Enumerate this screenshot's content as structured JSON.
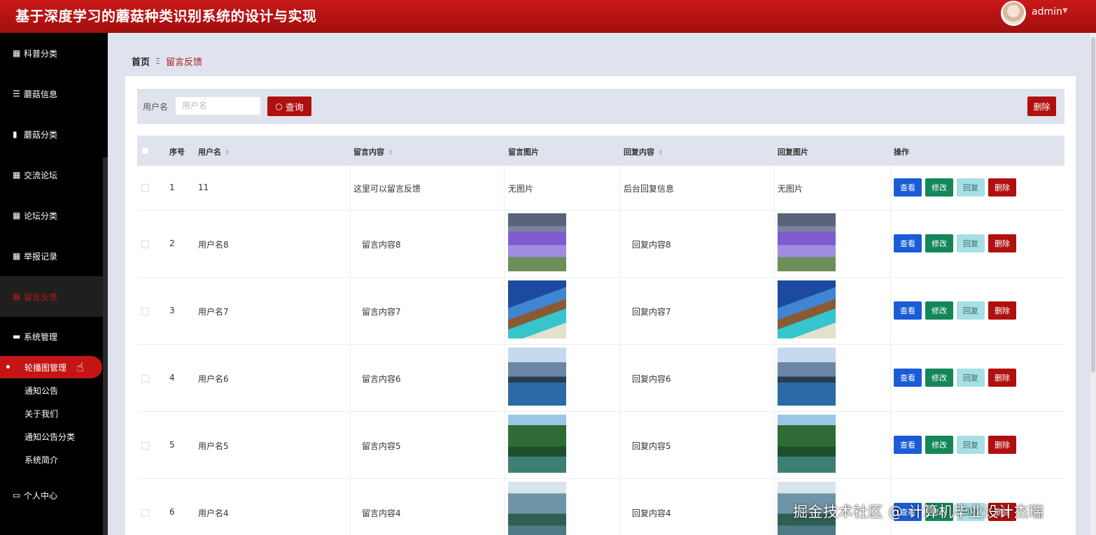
{
  "header": {
    "title": "基于深度学习的蘑菇种类识别系统的设计与实现",
    "username": "admin"
  },
  "sidebar": {
    "items": [
      {
        "label": "科普分类",
        "icon": "grid-icon"
      },
      {
        "label": "蘑菇信息",
        "icon": "list-icon"
      },
      {
        "label": "蘑菇分类",
        "icon": "book-icon"
      },
      {
        "label": "交流论坛",
        "icon": "grid-icon"
      },
      {
        "label": "论坛分类",
        "icon": "grid-icon"
      },
      {
        "label": "举报记录",
        "icon": "grid-icon"
      },
      {
        "label": "留言反馈",
        "icon": "grid-icon",
        "active": true
      },
      {
        "label": "系统管理",
        "icon": "monitor-icon"
      }
    ],
    "sub_items": [
      {
        "label": "轮播图管理",
        "selected": true
      },
      {
        "label": "通知公告"
      },
      {
        "label": "关于我们"
      },
      {
        "label": "通知公告分类"
      },
      {
        "label": "系统简介"
      }
    ],
    "personal": {
      "label": "个人中心",
      "icon": "card-icon"
    }
  },
  "breadcrumb": {
    "home": "首页",
    "separator": "Ξ",
    "current": "留言反馈"
  },
  "filter": {
    "label": "用户名",
    "placeholder": "用户名",
    "search_label": "查询",
    "delete_label": "删除"
  },
  "table": {
    "headers": [
      "序号",
      "用户名",
      "留言内容",
      "留言图片",
      "回复内容",
      "回复图片",
      "操作"
    ],
    "action_labels": {
      "view": "查看",
      "edit": "修改",
      "reply": "回复",
      "delete": "删除"
    },
    "rows": [
      {
        "index": "1",
        "username": "11",
        "content": "这里可以留言反馈",
        "image": "无图片",
        "reply": "后台回复信息",
        "reply_image": "无图片"
      },
      {
        "index": "2",
        "username": "用户名8",
        "content": "留言内容8",
        "image": "lavender-field",
        "reply": "回复内容8",
        "reply_image": "lavender-field"
      },
      {
        "index": "3",
        "username": "用户名7",
        "content": "留言内容7",
        "image": "tropical-beach",
        "reply": "回复内容7",
        "reply_image": "tropical-beach"
      },
      {
        "index": "4",
        "username": "用户名6",
        "content": "留言内容6",
        "image": "mountain-lake",
        "reply": "回复内容6",
        "reply_image": "mountain-lake"
      },
      {
        "index": "5",
        "username": "用户名5",
        "content": "留言内容5",
        "image": "forest-river",
        "reply": "回复内容5",
        "reply_image": "forest-river"
      },
      {
        "index": "6",
        "username": "用户名4",
        "content": "留言内容4",
        "image": "karst-river",
        "reply": "回复内容4",
        "reply_image": "karst-river"
      }
    ]
  },
  "watermark": "掘金技术社区 @ 计算机毕业设计杰瑞",
  "colors": {
    "brand": "#b01010",
    "view": "#1a5bd6",
    "edit": "#13875a",
    "reply": "#a8dfe5",
    "sidebar": "#000000"
  }
}
